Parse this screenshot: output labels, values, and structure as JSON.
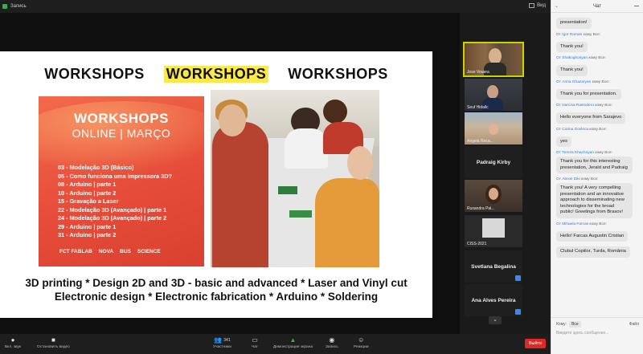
{
  "topbar": {
    "record_label": "Запись",
    "view_label": "Вид"
  },
  "slide": {
    "header": [
      "WORKSHOPS",
      "WORKSHOPS",
      "WORKSHOPS"
    ],
    "poster": {
      "title": "WORKSHOPS",
      "subtitle": "ONLINE | MARÇO",
      "items": [
        "03 - Modelação 3D (Básico)",
        "05 - Como funciona uma impressora 3D?",
        "08 - Arduino | parte 1",
        "10 - Arduino | parte 2",
        "15 - Gravação a Laser",
        "22 - Modelação 3D (Avançado) | parte 1",
        "24 - Modelação 3D (Avançado) | parte 2",
        "29 - Arduino | parte 1",
        "31 - Arduino | parte 2"
      ],
      "logos": [
        "FCT FABLAB",
        "NOVA",
        "BUS",
        "SCIENCE"
      ]
    },
    "caption_line1": "3D printing * Design 2D and 3D - basic and advanced * Laser and Vinyl cut",
    "caption_line2": "Electronic design * Electronic fabrication * Arduino * Soldering"
  },
  "gallery": {
    "tiles": [
      {
        "name": "Jose Vouera",
        "active": true
      },
      {
        "name": "Seuf Hidallc"
      },
      {
        "name": "Angela Reca..."
      },
      {
        "name": "Padraig Kirby",
        "text_only": true
      },
      {
        "name": "Ruxandra Pal..."
      },
      {
        "name": "CISS-2021"
      },
      {
        "name": "Svetlana Begalina",
        "text_only": true
      },
      {
        "name": "Ana Alves Pereira",
        "text_only": true
      }
    ],
    "more_label": "⌄"
  },
  "chat": {
    "title": "Чат",
    "messages": [
      {
        "from": "",
        "to": "",
        "text": "presentation!"
      },
      {
        "from": "От Igor Roman",
        "to": "кому Все:",
        "text": "Thank you!"
      },
      {
        "from": "От Shakoghosyan",
        "to": "кому Все:",
        "text": "Thank you!"
      },
      {
        "from": "От Anna Ghazaryan",
        "to": "кому Все:",
        "text": "Thank you for presentation."
      },
      {
        "from": "От Narcisa Rastodero",
        "to": "кому Все:",
        "text": "Hello everyone from Sarajevo"
      },
      {
        "from": "От Corina Dovleca",
        "to": "кому Все:",
        "text": "yes"
      },
      {
        "from": "От Tereza Khachoyan",
        "to": "кому Все:",
        "text": "Thank you for this interesting presentation, Jerald and Padraig"
      },
      {
        "from": "От Alexei Diki",
        "to": "кому Все:",
        "text": "Thank you! A very compelling presentation and an innovative approach to disseminating new technologies for the broad public! Greetings from Brasov!"
      },
      {
        "from": "От Mihaela Farcas",
        "to": "кому Все:",
        "text": "Hello! Farcas Augustin Cristian"
      },
      {
        "from": "",
        "to": "",
        "text": "Clubul Copiilor, Turda, România"
      }
    ],
    "to_label": "Кому:",
    "to_value": "Все",
    "file_label": "Файл",
    "input_placeholder": "Введите здесь сообщение..."
  },
  "toolbar": {
    "items": [
      {
        "label": "Вкл. звук",
        "icon": "mic-icon"
      },
      {
        "label": "Остановить видео",
        "icon": "video-icon"
      },
      {
        "label": "Участники",
        "icon": "participants-icon",
        "count": "341"
      },
      {
        "label": "Чат",
        "icon": "chat-icon"
      },
      {
        "label": "Демонстрация экрана",
        "icon": "share-screen-icon"
      },
      {
        "label": "Запись",
        "icon": "record-icon"
      },
      {
        "label": "Реакции",
        "icon": "reactions-icon"
      }
    ],
    "end_label": "Выйти"
  }
}
